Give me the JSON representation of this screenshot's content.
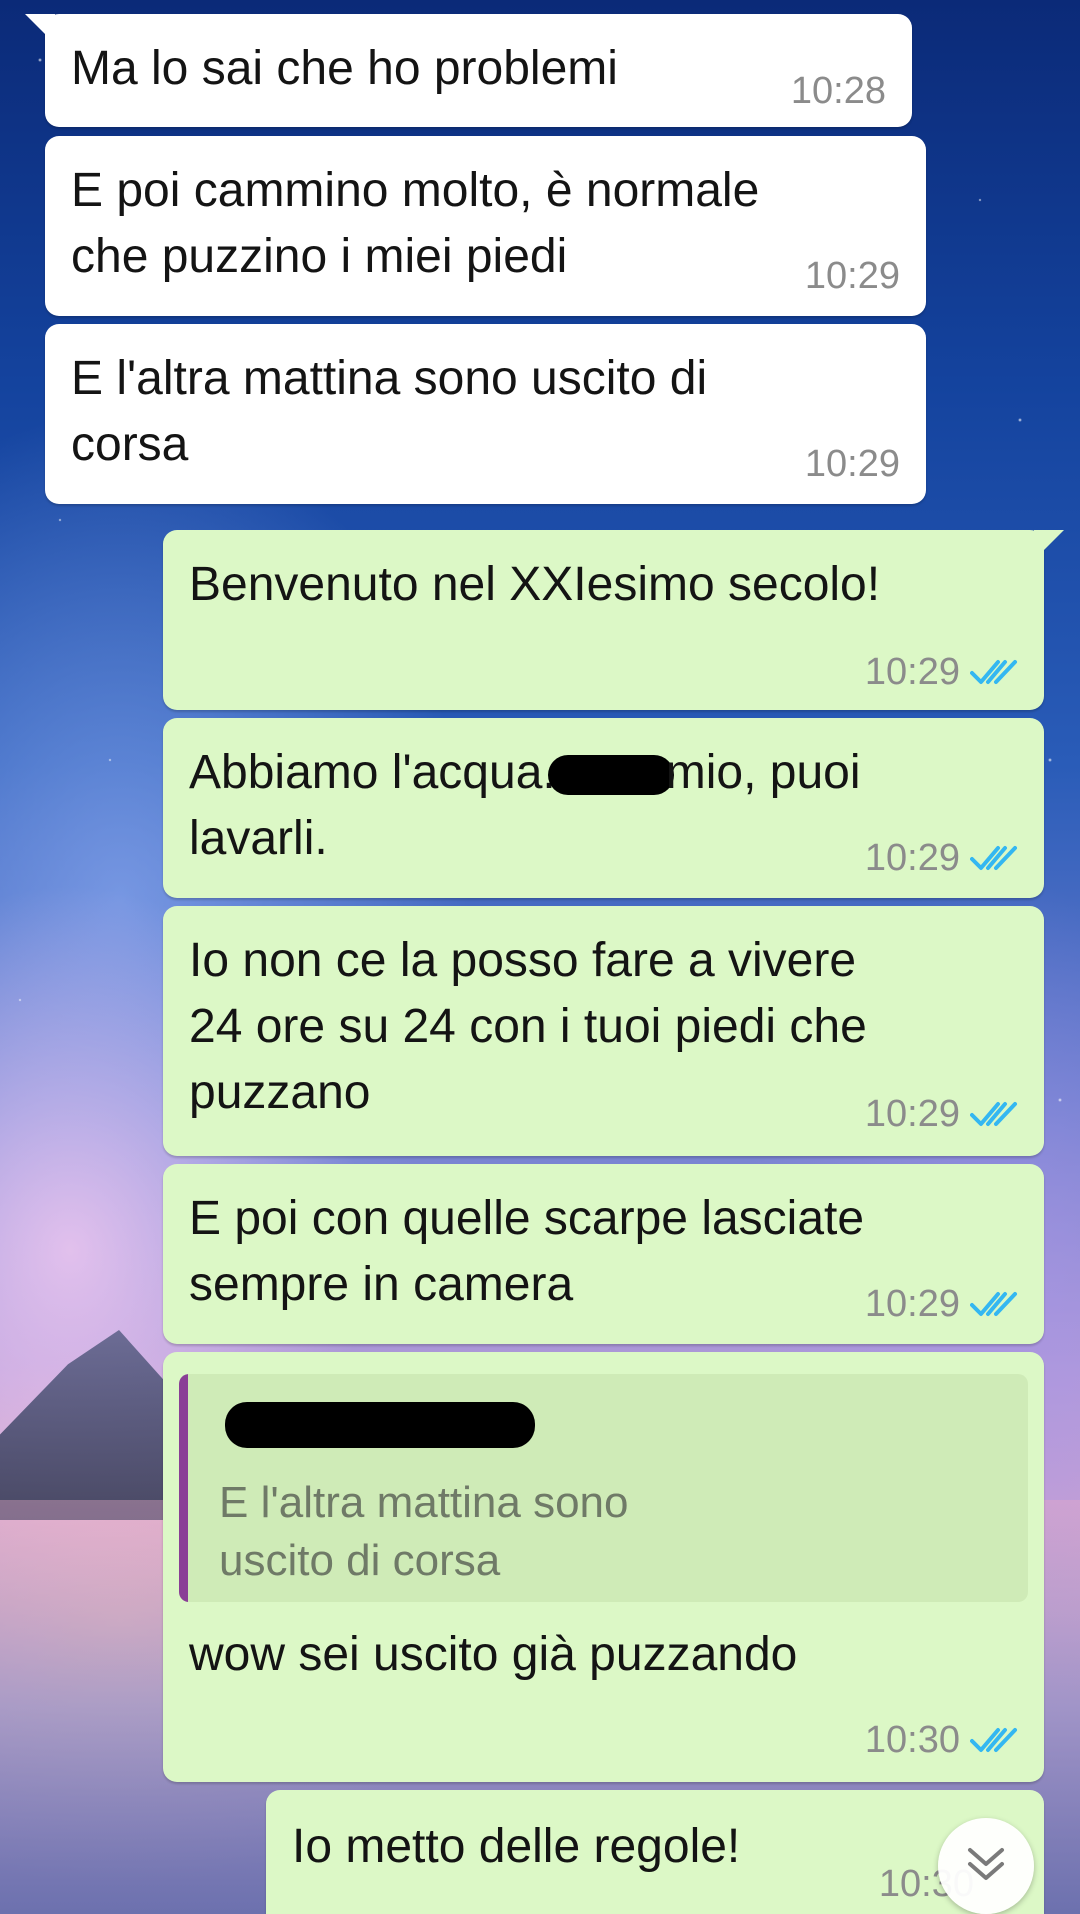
{
  "messages": [
    {
      "direction": "incoming",
      "text": "Ma lo sai che ho problemi",
      "time": "10:28"
    },
    {
      "direction": "incoming",
      "text": "E poi cammino molto, è normale\nche puzzino i miei piedi",
      "time": "10:29"
    },
    {
      "direction": "incoming",
      "text": "E l'altra mattina sono uscito di\ncorsa",
      "time": "10:29"
    },
    {
      "direction": "outgoing",
      "text": "Benvenuto nel XXIesimo secolo!",
      "time": "10:29",
      "status": "read"
    },
    {
      "direction": "outgoing",
      "text_before": "Abbiamo l'acqua.",
      "text_after": "mio, puoi\nlavarli.",
      "time": "10:29",
      "status": "read"
    },
    {
      "direction": "outgoing",
      "text": "Io non ce la posso fare a vivere\n24 ore su 24 con i tuoi piedi che\npuzzano",
      "time": "10:29",
      "status": "read"
    },
    {
      "direction": "outgoing",
      "text": "E poi con quelle scarpe lasciate\nsempre in camera",
      "time": "10:29",
      "status": "read"
    },
    {
      "direction": "outgoing",
      "quote": {
        "text": "E l'altra mattina sono\nuscito di corsa"
      },
      "text": "wow sei uscito già puzzando",
      "time": "10:30",
      "status": "read"
    },
    {
      "direction": "outgoing",
      "text": "Io metto delle regole!",
      "time": "10:30",
      "status": "read"
    }
  ],
  "icons": {
    "read_receipt": "double-check-icon",
    "scroll_down": "double-chevron-down-icon"
  },
  "colors": {
    "incoming_bubble": "#ffffff",
    "outgoing_bubble": "#dcf8c6",
    "read_tick": "#34b7f1",
    "quote_bar": "#8a3f96"
  }
}
